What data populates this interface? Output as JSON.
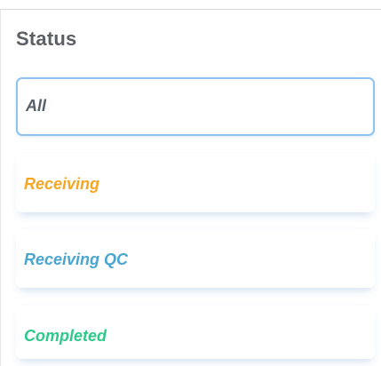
{
  "status_filter": {
    "title": "Status",
    "selected": "All",
    "options": [
      {
        "label": "Receiving",
        "color": "#f5a623"
      },
      {
        "label": "Receiving QC",
        "color": "#4aa6cf"
      },
      {
        "label": "Completed",
        "color": "#2ec98a"
      }
    ]
  }
}
